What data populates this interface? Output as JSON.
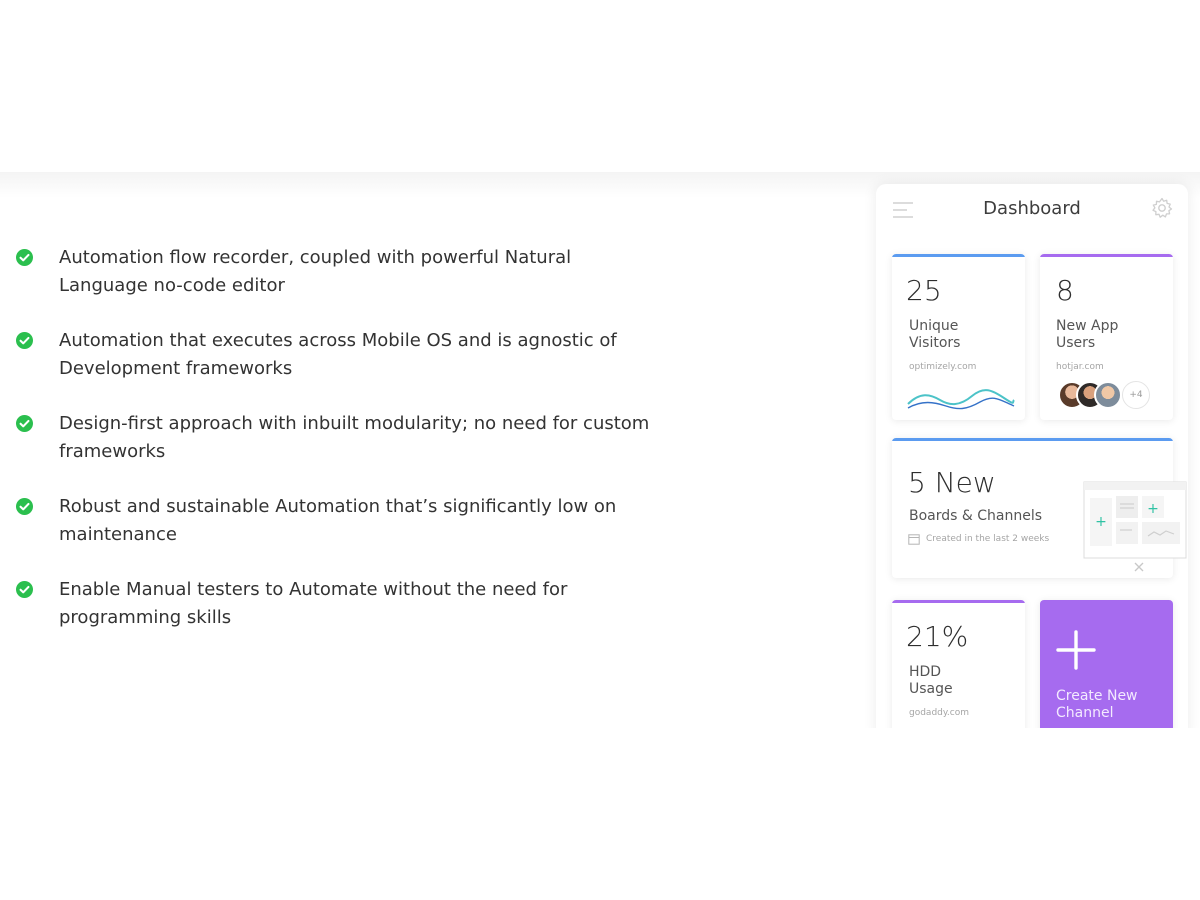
{
  "features": {
    "items": [
      {
        "text": "Automation flow recorder, coupled with powerful Natural Language no-code editor"
      },
      {
        "text": "Automation that executes across Mobile OS and is agnostic of Development frameworks"
      },
      {
        "text": "Design-first approach with inbuilt modularity; no need for custom frameworks"
      },
      {
        "text": "Robust and sustainable Automation that’s significantly low on maintenance"
      },
      {
        "text": "Enable Manual testers to Automate without the need for programming skills"
      }
    ],
    "check_color": "#2bbf4e"
  },
  "dashboard": {
    "title": "Dashboard",
    "visitors": {
      "value": "25",
      "label_line1": "Unique",
      "label_line2": "Visitors",
      "source": "optimizely.com",
      "accent": "#5b9bf0"
    },
    "app_users": {
      "value": "8",
      "label_line1": "New App",
      "label_line2": "Users",
      "source": "hotjar.com",
      "more": "+4",
      "accent": "#a66bef"
    },
    "boards": {
      "value": "5 New",
      "label": "Boards & Channels",
      "note": "Created in the last 2 weeks",
      "accent": "#5b9bf0"
    },
    "hdd": {
      "value": "21%",
      "label_line1": "HDD",
      "label_line2": "Usage",
      "source": "godaddy.com",
      "accent": "#a66bef"
    },
    "create": {
      "label_line1": "Create New",
      "label_line2": "Channel",
      "color": "#a66bef"
    }
  }
}
